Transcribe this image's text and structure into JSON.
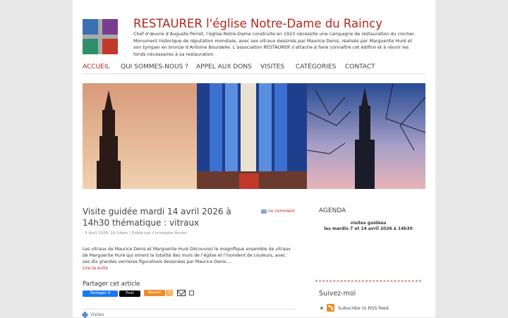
{
  "site": {
    "title": "RESTAURER l'église Notre-Dame du Raincy",
    "description": "Chef d’œuvre d’Auguste Perret, l’église Notre-Dame construite en 1923 nécessite une campagne de restauration du clocher. Monument historique de réputation mondiale, avec ses vitraux dessinés par Maurice Denis, réalisés par Marguerite Huré et son tympan en bronze d’Antoine Bourdelle. L’association RESTAURER s’attache à faire connaître cet édifice et à réunir les fonds nécessaires à sa restauration."
  },
  "nav": {
    "items": [
      {
        "label": "ACCUEIL"
      },
      {
        "label": "QUI SOMMES-NOUS ?"
      },
      {
        "label": "APPEL AUX DONS"
      },
      {
        "label": "VISITES"
      },
      {
        "label": "CATÉGORIES"
      },
      {
        "label": "CONTACT"
      }
    ]
  },
  "post": {
    "title": "Visite guidée mardi 14 avril 2026 à 14h30 thématique : vitraux",
    "comments": "no comment",
    "meta": "3 Avril 2026, 19:24pm | Publié par Christophe Amion",
    "excerpt": "Les vitraux de Maurice Denis et Marguerite Huré Découvrez le magnifique ensemble de vitraux de Marguerite Huré qui ornent la totalité des murs de l’église et l’inondent de couleurs, avec ses dix grandes verrières figuratives dessinées par Maurice Denis....",
    "read_more": "Lire la suite",
    "category": "Visites"
  },
  "share": {
    "title": "Partager cet article",
    "facebook": "Partager 0",
    "x": "Post",
    "repost": "Repost",
    "repost_count": "0"
  },
  "sidebar": {
    "agenda_title": "AGENDA",
    "agenda_line1": "visites guidées",
    "agenda_line2": "les mardis 7 et 14 avril 2026 à 14h30",
    "follow_title": "Suivez-moi",
    "rss_label": "Subscribe to RSS feed"
  },
  "icons": {
    "logo": "stained-glass-cross-logo",
    "comments": "comment-bubble-icon",
    "mail": "mail-icon",
    "print": "print-icon",
    "rss": "rss-icon",
    "category": "tag-icon"
  },
  "colors": {
    "accent": "#b0271e",
    "facebook": "#1877f2",
    "repost": "#f08a24"
  }
}
